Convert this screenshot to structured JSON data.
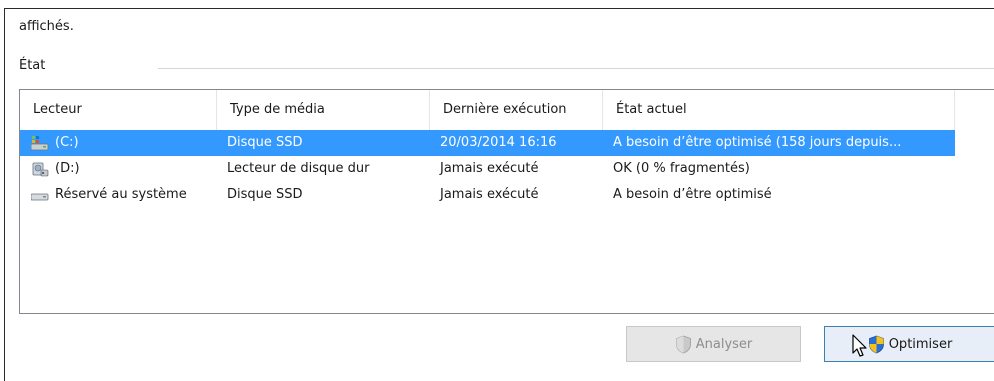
{
  "intro": {
    "text": "affichés."
  },
  "status_group": {
    "label": "État"
  },
  "drive_list": {
    "columns": [
      {
        "label": "Lecteur"
      },
      {
        "label": "Type de média"
      },
      {
        "label": "Dernière exécution"
      },
      {
        "label": "État actuel"
      }
    ],
    "rows": [
      {
        "drive": "(C:)",
        "media_type": "Disque SSD",
        "last_run": "20/03/2014 16:16",
        "status": "A besoin d’être optimisé (158 jours depuis...",
        "icon": "system-drive-icon",
        "selected": true
      },
      {
        "drive": "(D:)",
        "media_type": "Lecteur de disque dur",
        "last_run": "Jamais exécuté",
        "status": "OK (0 % fragmentés)",
        "icon": "hard-drive-icon",
        "selected": false
      },
      {
        "drive": "Réservé au système",
        "media_type": "Disque SSD",
        "last_run": "Jamais exécuté",
        "status": "A besoin d’être optimisé",
        "icon": "reserved-drive-icon",
        "selected": false
      }
    ]
  },
  "buttons": {
    "analyze": {
      "label": "Analyser",
      "enabled": false,
      "icon": "uac-shield-icon"
    },
    "optimize": {
      "label": "Optimiser",
      "enabled": true,
      "icon": "uac-shield-icon"
    }
  },
  "colors": {
    "selection": "#3399ff",
    "selection_text": "#ffffff",
    "focus_border": "#3c7fb1",
    "disabled_text": "#8d8d8d"
  }
}
